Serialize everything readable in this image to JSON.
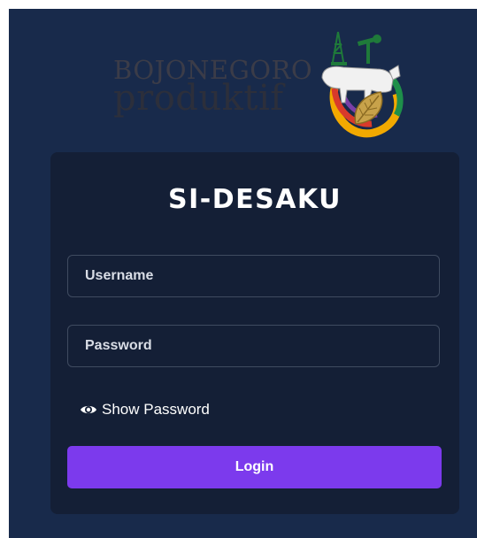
{
  "logo": {
    "line1": "BOJONEGORO",
    "line2": "produktif"
  },
  "login_card": {
    "title": "SI-DESAKU",
    "username_placeholder": "Username",
    "password_placeholder": "Password",
    "show_password_label": "Show Password",
    "login_label": "Login"
  },
  "colors": {
    "background": "#182a4b",
    "card": "#141f36",
    "field_border": "#3f4b60",
    "button": "#7c3aed",
    "text": "#ffffff"
  },
  "icons": {
    "show_password": "eye-icon"
  }
}
